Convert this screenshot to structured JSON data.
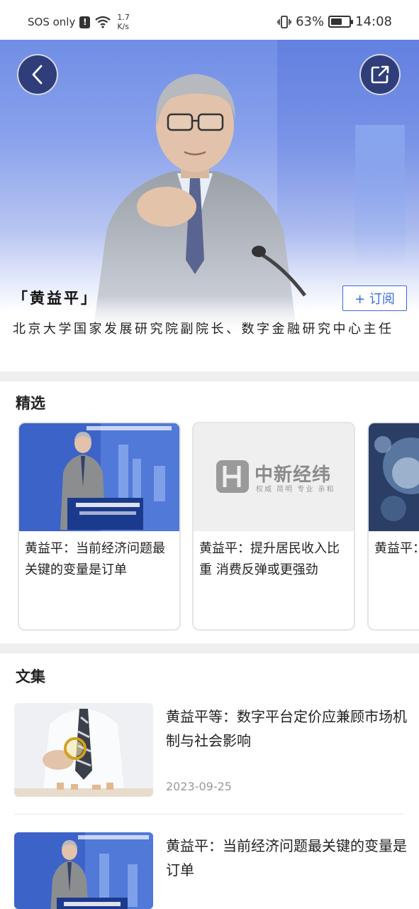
{
  "status_bar": {
    "carrier": "SOS only",
    "signal_badge": "!",
    "net_speed_value": "1.7",
    "net_speed_unit": "K/s",
    "battery_percent": "63%",
    "battery_level": 0.63,
    "time": "14:08"
  },
  "hero": {
    "author_name": "「黄益平」",
    "subscribe_label": "+ 订阅",
    "description": "北京大学国家发展研究院副院长、数字金融研究中心主任"
  },
  "featured": {
    "title": "精选",
    "cards": [
      {
        "title": "黄益平：当前经济问题最关键的变量是订单",
        "image": "speaker-photo"
      },
      {
        "title": "黄益平：提升居民收入比重 消费反弹或更强劲",
        "image": "logo-placeholder",
        "logo_text": "中新经纬",
        "logo_slogan": "权威 简明 专业 亲和"
      },
      {
        "title": "黄益平：推动经济",
        "image": "abstract-tech"
      }
    ]
  },
  "collection": {
    "title": "文集",
    "articles": [
      {
        "title": "黄益平等：数字平台定价应兼顾市场机制与社会影响",
        "date": "2023-09-25",
        "thumb": "magnifier-photo"
      },
      {
        "title": "黄益平：当前经济问题最关键的变量是订单",
        "date": "",
        "thumb": "speaker-photo"
      }
    ]
  },
  "icons": {
    "back": "back-arrow-icon",
    "share": "share-icon",
    "wifi": "wifi-icon",
    "vibrate": "vibrate-icon",
    "battery": "battery-icon"
  },
  "colors": {
    "accent": "#3a6bd6",
    "hero_button_bg": "#2f3d7a",
    "divider": "#efefef",
    "date_text": "#999999"
  }
}
